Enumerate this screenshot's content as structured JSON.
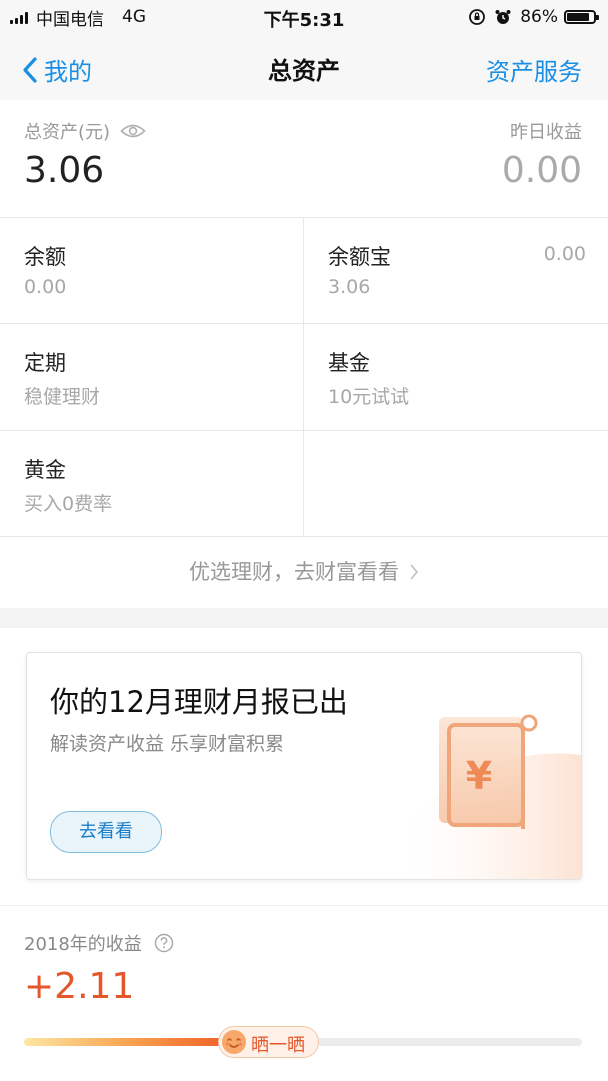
{
  "status_bar": {
    "carrier": "中国电信",
    "network": "4G",
    "time": "下午5:31",
    "battery": "86%",
    "battery_level": 0.86
  },
  "nav": {
    "back_label": "我的",
    "title": "总资产",
    "right_label": "资产服务"
  },
  "summary": {
    "total_label": "总资产(元)",
    "total_value": "3.06",
    "yesterday_label": "昨日收益",
    "yesterday_value": "0.00"
  },
  "grid": [
    {
      "title": "余额",
      "sub": "0.00",
      "extra": ""
    },
    {
      "title": "余额宝",
      "sub": "3.06",
      "extra": "0.00"
    },
    {
      "title": "定期",
      "sub": "稳健理财",
      "extra": ""
    },
    {
      "title": "基金",
      "sub": "10元试试",
      "extra": ""
    },
    {
      "title": "黄金",
      "sub": "买入0费率",
      "extra": ""
    }
  ],
  "more_link": "优选理财，去财富看看",
  "report": {
    "title": "你的12月理财月报已出",
    "subtitle": "解读资产收益 乐享财富积累",
    "button": "去看看"
  },
  "earnings": {
    "label": "2018年的收益",
    "value": "+2.11",
    "progress": 0.38,
    "share_label": "晒一晒"
  },
  "colors": {
    "accent": "#1a8fe6",
    "earn": "#e5562a"
  }
}
